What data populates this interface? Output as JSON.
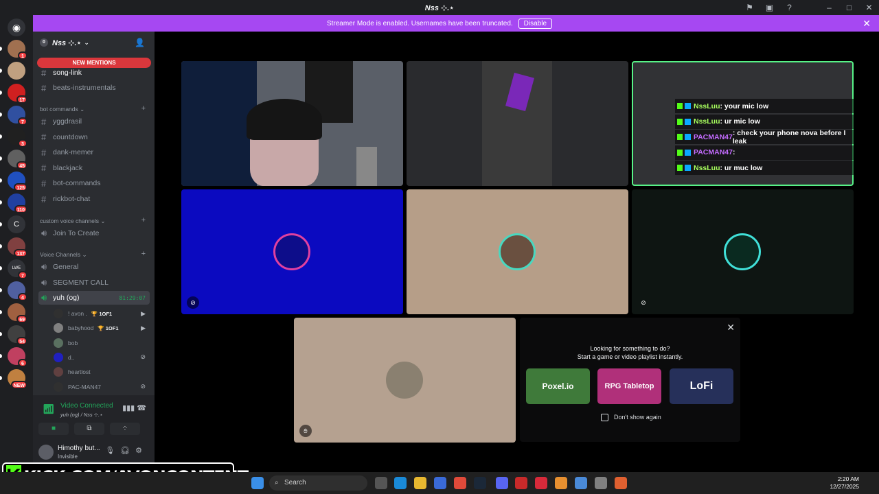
{
  "window": {
    "title": "Nss ⊹.⋆"
  },
  "banner": {
    "text": "Streamer Mode is enabled. Usernames have been truncated.",
    "disable_label": "Disable"
  },
  "servers": [
    {
      "badge": "1",
      "color": "#a07050"
    },
    {
      "badge": "",
      "color": "#c0a080"
    },
    {
      "badge": "17",
      "color": "#d02020"
    },
    {
      "badge": "7",
      "color": "#3050a0"
    },
    {
      "badge": "3",
      "color": "#202020"
    },
    {
      "badge": "45",
      "color": "#606060"
    },
    {
      "badge": "125",
      "color": "#2050c0"
    },
    {
      "badge": "110",
      "color": "#2040a0"
    },
    {
      "badge": "",
      "letter": "C",
      "color": "#313338"
    },
    {
      "badge": "137",
      "color": "#804040"
    },
    {
      "badge": "7",
      "letter": "LWE",
      "color": "#313338"
    },
    {
      "badge": "4",
      "color": "#5060a0"
    },
    {
      "badge": "69",
      "color": "#a06040"
    },
    {
      "badge": "54",
      "color": "#404040"
    },
    {
      "badge": "6",
      "color": "#c04060"
    },
    {
      "badge": "NEW",
      "color": "#c08040"
    }
  ],
  "server": {
    "name": "Nss ⊹.⋆",
    "badge": "0"
  },
  "mentions_label": "NEW MENTIONS",
  "channels_top": [
    "song-link",
    "beats-instrumentals"
  ],
  "categories": {
    "bot": "bot commands",
    "custom": "custom voice channels",
    "voice": "Voice Channels"
  },
  "bot_channels": [
    "yggdrasil",
    "countdown",
    "dank-memer",
    "blackjack",
    "bot-commands",
    "rickbot-chat"
  ],
  "custom_channels": [
    "Join To Create"
  ],
  "voice_channels": [
    "General",
    "SEGMENT CALL"
  ],
  "active_voice": {
    "name": "yuh (og)",
    "time": "81:29:07"
  },
  "voice_users": [
    {
      "name": "! avon .",
      "tag": "🏆 1OF1",
      "icon": "▶",
      "color": "#303030"
    },
    {
      "name": "babyhood",
      "tag": "🏆 1OF1",
      "icon": "▶",
      "color": "#808080"
    },
    {
      "name": "bob",
      "tag": "",
      "icon": "",
      "color": "#5a7060"
    },
    {
      "name": "d..",
      "tag": "",
      "icon": "⊘",
      "color": "#2020c0"
    },
    {
      "name": "heartlost",
      "tag": "",
      "icon": "",
      "color": "#604040"
    },
    {
      "name": "PAC-MAN47",
      "tag": "",
      "icon": "⊘",
      "color": "#303030"
    }
  ],
  "voice_panel": {
    "status": "Video Connected",
    "location": "yuh (og) / Nss ⊹.⋆"
  },
  "user": {
    "name": "Himothy but...",
    "status": "Invisible"
  },
  "chat_overlay": [
    {
      "user": "NssLuu",
      "text": ": your mic low",
      "color": "#a8ff5e"
    },
    {
      "user": "NssLuu",
      "text": ": ur mic low",
      "color": "#a8ff5e"
    },
    {
      "user": "PACMAN47",
      "text": ": check your phone nova before I leak",
      "color": "#c46cff"
    },
    {
      "user": "PACMAN47",
      "text": ":",
      "color": "#c46cff"
    },
    {
      "user": "NssLuu",
      "text": ": ur muc low",
      "color": "#a8ff5e"
    }
  ],
  "activity": {
    "line1": "Looking for something to do?",
    "line2": "Start a game or video playlist instantly.",
    "cards": [
      "Poxel.io",
      "RPG Tabletop",
      "LoFi"
    ],
    "dont_show": "Don't show again"
  },
  "overlay": {
    "kick_text": "KICK.COM/AVONCONTENT",
    "kick_letter": "K"
  },
  "taskbar": {
    "search": "Search",
    "time": "2:20 AM",
    "date": "12/27/2025"
  },
  "colors": {
    "accent": "#a648f2",
    "green": "#23a55a",
    "kick": "#53fc18"
  }
}
